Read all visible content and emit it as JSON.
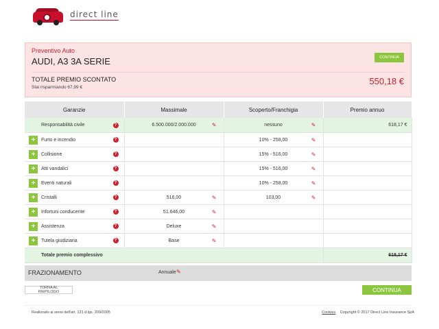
{
  "brand": {
    "logo_text": "direct line"
  },
  "quote": {
    "label": "Preventivo Auto",
    "car": "AUDI, A3 3A SERIE",
    "continue_label": "CONTINUA",
    "total_label": "TOTALE PREMIO SCONTATO",
    "savings": "Stai risparmiando 67,99 €",
    "price": "550,18 €"
  },
  "table": {
    "headers": [
      "Garanzie",
      "Massimale",
      "Scoperto/Franchigia",
      "Premio annuo"
    ],
    "base": {
      "name": "Responsabilità civile",
      "massimale": "6.500.000/2.000.000",
      "scoperto": "nessuno",
      "premio": "618,17 €"
    },
    "rows": [
      {
        "name": "Furto e incendio",
        "massimale": "",
        "scoperto": "10% - 258,00"
      },
      {
        "name": "Collisione",
        "massimale": "",
        "scoperto": "15% - 516,00"
      },
      {
        "name": "Atti vandalici",
        "massimale": "",
        "scoperto": "15% - 516,00"
      },
      {
        "name": "Eventi naturali",
        "massimale": "",
        "scoperto": "10% - 258,00"
      },
      {
        "name": "Cristalli",
        "massimale": "516,00",
        "scoperto": "103,00"
      },
      {
        "name": "Infortuni conducente",
        "massimale": "51.646,00",
        "scoperto": ""
      },
      {
        "name": "Assistenza",
        "massimale": "Deluxe",
        "scoperto": ""
      },
      {
        "name": "Tutela giudiziaria",
        "massimale": "Base",
        "scoperto": ""
      }
    ],
    "total_label": "Totale premio complessivo",
    "total_value": "618,17 €"
  },
  "frazionamento": {
    "label": "FRAZIONAMENTO",
    "value": "Annuale"
  },
  "actions": {
    "back_label": "TORNA AL RIEPILOGO",
    "continue_label": "CONTINUA"
  },
  "footer": {
    "left": "Realizzato ai sensi dell'art. 131 d.lgs. 209/2005",
    "cookies": "Cookies",
    "copyright": "Copyright © 2017 Direct Line Insurance SpA"
  },
  "colors": {
    "accent_red": "#d0202e",
    "accent_green": "#8cc63f",
    "quote_bg": "#fce4e4"
  }
}
